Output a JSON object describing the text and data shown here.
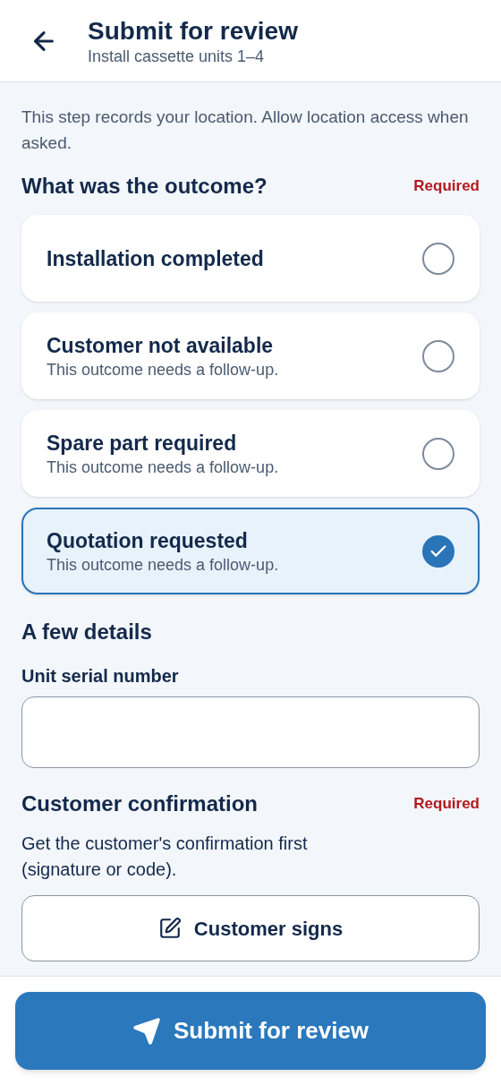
{
  "header": {
    "title": "Submit for review",
    "subtitle": "Install cassette units 1–4"
  },
  "notice": "This step records your location. Allow location access when asked.",
  "outcome": {
    "heading": "What was the outcome?",
    "required": "Required",
    "options": [
      {
        "label": "Installation completed",
        "selected": false
      },
      {
        "label": "Customer not available",
        "note": "This outcome needs a follow-up.",
        "selected": false
      },
      {
        "label": "Spare part required",
        "note": "This outcome needs a follow-up.",
        "selected": false
      },
      {
        "label": "Quotation requested",
        "note": "This outcome needs a follow-up.",
        "selected": true
      }
    ]
  },
  "details": {
    "heading": "A few details",
    "fields": [
      {
        "label": "Unit serial number"
      }
    ]
  },
  "confirmation": {
    "heading": "Customer confirmation",
    "required": "Required",
    "text": "Get the customer's confirmation first (signature or code).",
    "button": "Customer signs"
  },
  "submit": "Submit for review"
}
